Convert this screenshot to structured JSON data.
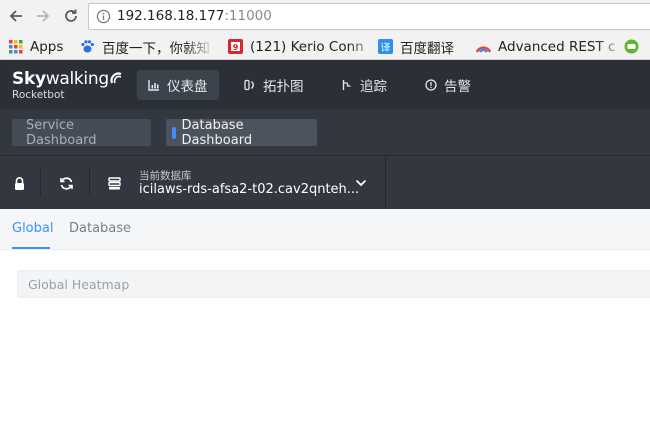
{
  "browser": {
    "url_host": "192.168.18.177",
    "url_port": ":11000",
    "bookmarks": [
      {
        "label": "Apps",
        "icon": "apps-grid-icon"
      },
      {
        "label": "百度一下，你就知",
        "icon": "baidu-paw-icon"
      },
      {
        "label": "(121) Kerio Conn",
        "icon": "kerio-icon"
      },
      {
        "label": "百度翻译",
        "icon": "baidu-translate-icon"
      },
      {
        "label": "Advanced REST c",
        "icon": "arc-icon"
      }
    ]
  },
  "app": {
    "logo_title_sky": "Sky",
    "logo_title_walking": "walking",
    "logo_subtitle": "Rocketbot",
    "menu": [
      {
        "label": "仪表盘",
        "icon": "bar-chart-icon",
        "active": true
      },
      {
        "label": "拓扑图",
        "icon": "topology-icon",
        "active": false
      },
      {
        "label": "追踪",
        "icon": "trace-icon",
        "active": false
      },
      {
        "label": "告警",
        "icon": "alert-icon",
        "active": false
      }
    ],
    "dashboards": [
      {
        "label": "Service Dashboard",
        "active": false
      },
      {
        "label": "Database Dashboard",
        "active": true
      }
    ],
    "toolbar": {
      "db_label": "当前数据库",
      "db_value": "icilaws-rds-afsa2-t02.cav2qnteh..."
    },
    "subtabs": [
      {
        "label": "Global",
        "active": true
      },
      {
        "label": "Database",
        "active": false
      }
    ],
    "panel": {
      "title": "Global Heatmap"
    }
  },
  "colors": {
    "header_bg": "#2b3037",
    "bar_bg": "#333840",
    "accent": "#3d92ff"
  }
}
